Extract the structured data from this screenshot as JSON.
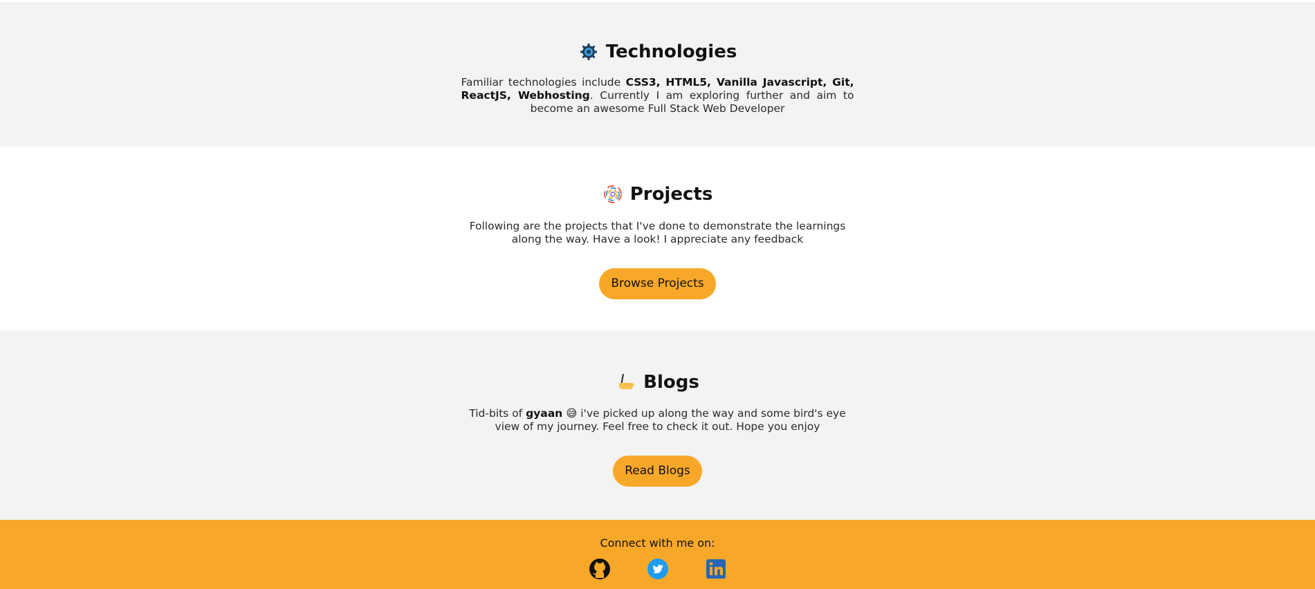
{
  "technologies": {
    "title": "Technologies",
    "icon": "gear-icon",
    "desc_prefix": "Familiar technologies include ",
    "desc_bold": "CSS3, HTML5, Vanilla Javascript, Git, ReactJS, Webhosting",
    "desc_suffix": ". Currently I am exploring further and aim to become an awesome Full Stack Web Developer"
  },
  "projects": {
    "title": "Projects",
    "icon": "projects-swirl-icon",
    "desc": "Following are the projects that I've done to demonstrate the learnings along the way. Have a look! I appreciate any feedback",
    "button_label": "Browse Projects"
  },
  "blogs": {
    "title": "Blogs",
    "icon": "writing-hand-icon",
    "desc_prefix": "Tid-bits of ",
    "desc_bold": "gyaan",
    "desc_emoji": "😅",
    "desc_suffix": " i've picked up along the way and some bird's eye view of my journey. Feel free to check it out. Hope you enjoy",
    "button_label": "Read Blogs"
  },
  "footer": {
    "connect_label": "Connect with me on:",
    "social": [
      {
        "name": "github",
        "icon": "github-icon"
      },
      {
        "name": "twitter",
        "icon": "twitter-icon"
      },
      {
        "name": "linkedin",
        "icon": "linkedin-icon"
      }
    ]
  },
  "colors": {
    "accent": "#f8a828",
    "section_alt_bg": "#f3f3f3",
    "twitter_blue": "#1d9bf0",
    "linkedin_blue": "#2a66b6"
  }
}
